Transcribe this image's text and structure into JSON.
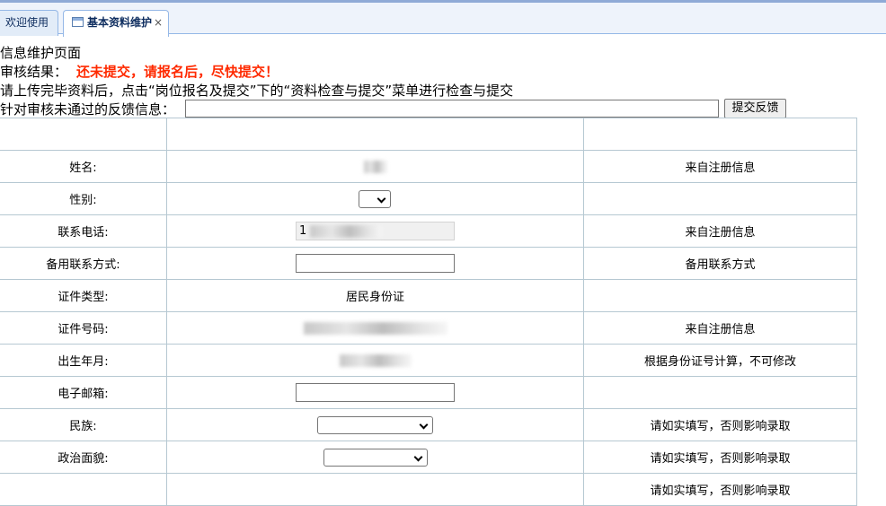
{
  "tabs": [
    {
      "label": "欢迎使用"
    },
    {
      "label": "基本资料维护",
      "close": "×"
    }
  ],
  "page": {
    "title": "信息维护页面",
    "audit_label": "审核结果：",
    "audit_status": "还未提交，请报名后，尽快提交！",
    "instruction": "请上传完毕资料后，点击“岗位报名及提交”下的“资料检查与提交”菜单进行检查与提交",
    "feedback_label": "针对审核未通过的反馈信息：",
    "feedback_value": "",
    "feedback_button": "提交反馈"
  },
  "form": {
    "name": {
      "label": "姓名:",
      "note": "来自注册信息"
    },
    "gender": {
      "label": "性别:",
      "selected": "",
      "note": ""
    },
    "phone": {
      "label": "联系电话:",
      "value": "1",
      "note": "来自注册信息"
    },
    "alt_contact": {
      "label": "备用联系方式:",
      "value": "",
      "note": "备用联系方式"
    },
    "id_type": {
      "label": "证件类型:",
      "value": "居民身份证",
      "note": ""
    },
    "id_number": {
      "label": "证件号码:",
      "note": "来自注册信息"
    },
    "birth": {
      "label": "出生年月:",
      "note": "根据身份证号计算，不可修改"
    },
    "email": {
      "label": "电子邮箱:",
      "value": "",
      "note": ""
    },
    "ethnicity": {
      "label": "民族:",
      "selected": "",
      "note": "请如实填写，否则影响录取"
    },
    "political": {
      "label": "政治面貌:",
      "selected": "",
      "note": "请如实填写，否则影响录取"
    },
    "next_note": "请如实填写，否则影响录取"
  }
}
